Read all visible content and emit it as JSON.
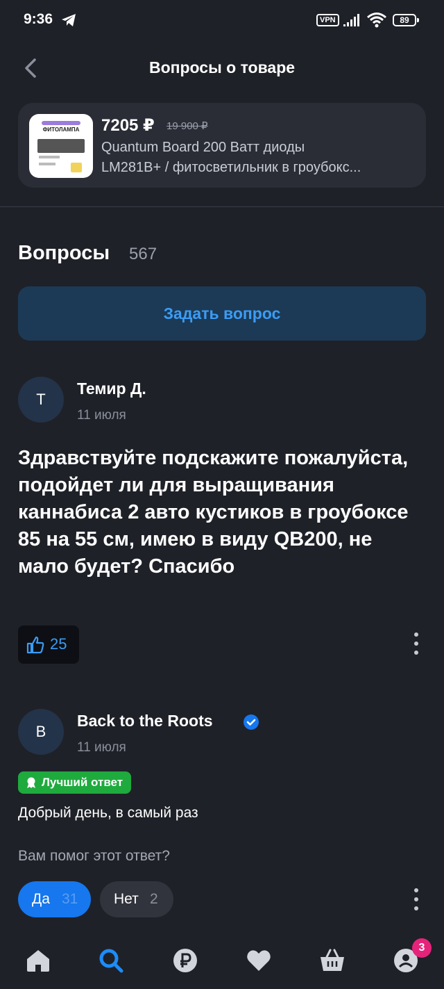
{
  "status_bar": {
    "time": "9:36",
    "vpn": "VPN",
    "battery": "89"
  },
  "header": {
    "title": "Вопросы о товаре"
  },
  "product": {
    "thumb_label": "ФИТОЛАМПА",
    "price": "7205 ₽",
    "old_price": "19 900 ₽",
    "name_line1": "Quantum Board 200 Ватт диоды",
    "name_line2": "LM281B+ / фитосветильник в гроубокс..."
  },
  "questions": {
    "title": "Вопросы",
    "count": "567",
    "ask_button": "Задать вопрос"
  },
  "question": {
    "avatar_letter": "Т",
    "author": "Темир Д.",
    "date": "11 июля",
    "text": "Здравствуйте подскажите пожалуйста, подойдет ли для выращивания каннабиса 2 авто кустиков в гроубоксе 85 на 55 см, имею в виду QB200, не мало будет? Спасибо",
    "likes": "25"
  },
  "answer": {
    "avatar_letter": "В",
    "author": "Back to the Roots",
    "date": "11 июля",
    "badge": "Лучший ответ",
    "text": "Добрый день, в самый раз",
    "helped_question": "Вам помог этот ответ?",
    "yes_label": "Да",
    "yes_count": "31",
    "no_label": "Нет",
    "no_count": "2"
  },
  "nav": {
    "items": [
      "home-icon",
      "search-icon",
      "ruble-icon",
      "heart-icon",
      "basket-icon",
      "profile-icon"
    ],
    "profile_badge": "3"
  },
  "colors": {
    "background": "#1f2128",
    "accent": "#1677ee",
    "link": "#3b9cf5",
    "best": "#1faa3e",
    "badge": "#e6237a"
  }
}
